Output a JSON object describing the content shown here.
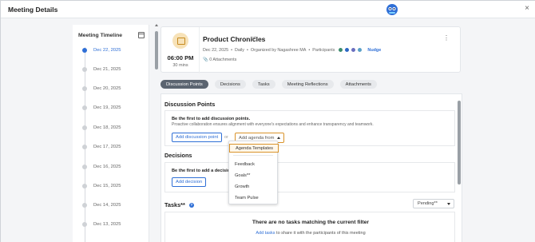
{
  "window": {
    "title": "Meeting Details",
    "close_glyph": "×"
  },
  "timeline": {
    "header": "Meeting Timeline",
    "dates": [
      "Dec 22, 2025",
      "Dec 21, 2025",
      "Dec 20, 2025",
      "Dec 19, 2025",
      "Dec 18, 2025",
      "Dec 17, 2025",
      "Dec 16, 2025",
      "Dec 15, 2025",
      "Dec 14, 2025",
      "Dec 13, 2025"
    ],
    "active_index": 0
  },
  "meeting": {
    "time": "06:00 PM",
    "duration": "30 mins",
    "name": "Product Chronicles",
    "date": "Dec 22, 2025",
    "frequency": "Daily",
    "organizer": "Organized by Nagashree MA",
    "participants_label": "Participants",
    "nudge": "Nudge",
    "attachments": "0 Attachments",
    "avatar_colors": [
      "#3c8c6e",
      "#2b67c4",
      "#6a6fbf",
      "#5aa0c8"
    ]
  },
  "tabs": [
    "Discussion Points",
    "Decisions",
    "Tasks",
    "Meeting Reflections",
    "Attachments"
  ],
  "active_tab": 0,
  "discussion": {
    "header": "Discussion Points",
    "empty_title": "Be the first to add discussion points.",
    "empty_desc": "Proactive collaboration ensures alignment with everyone's expectations and enhance transparency and teamwork.",
    "add_button": "Add discussion point",
    "or": "or",
    "agenda_button": "Add agenda from"
  },
  "decisions": {
    "header": "Decisions",
    "empty_title": "Be the first to add a decision.",
    "add_button": "Add decision"
  },
  "tasks": {
    "header": "Tasks**",
    "filter": "Pending**",
    "empty_title": "There are no tasks matching the current filter",
    "link": "Add tasks",
    "rest": " to share it with the participants of this meeting"
  },
  "agenda_menu": {
    "items": [
      "Agenda Templates",
      "Feedback",
      "Goals**",
      "Growth",
      "Team Pulse"
    ],
    "selected_index": 0
  }
}
